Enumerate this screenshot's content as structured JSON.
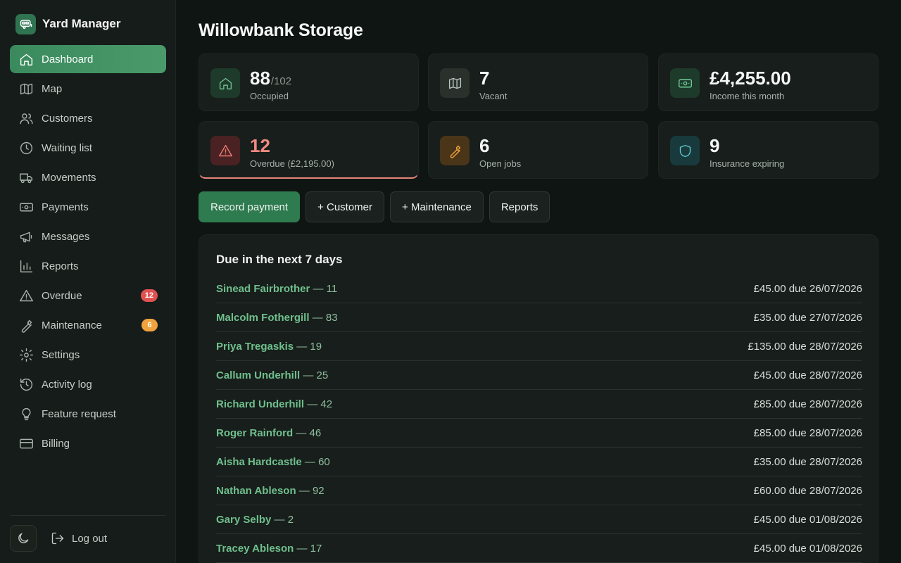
{
  "app": {
    "name": "Yard Manager"
  },
  "sidebar": {
    "items": [
      {
        "label": "Dashboard",
        "icon": "home-icon",
        "active": true
      },
      {
        "label": "Map",
        "icon": "map-icon"
      },
      {
        "label": "Customers",
        "icon": "users-icon"
      },
      {
        "label": "Waiting list",
        "icon": "clock-icon"
      },
      {
        "label": "Movements",
        "icon": "truck-icon"
      },
      {
        "label": "Payments",
        "icon": "banknote-icon"
      },
      {
        "label": "Messages",
        "icon": "megaphone-icon"
      },
      {
        "label": "Reports",
        "icon": "bar-chart-icon"
      },
      {
        "label": "Overdue",
        "icon": "alert-triangle-icon",
        "badge": "12"
      },
      {
        "label": "Maintenance",
        "icon": "wrench-icon",
        "badge": "6"
      },
      {
        "label": "Settings",
        "icon": "gear-icon"
      },
      {
        "label": "Activity log",
        "icon": "history-icon"
      },
      {
        "label": "Feature request",
        "icon": "lightbulb-icon"
      },
      {
        "label": "Billing",
        "icon": "credit-card-icon"
      }
    ],
    "logout_label": "Log out",
    "theme_toggle_icon": "moon-icon"
  },
  "page": {
    "title": "Willowbank Storage"
  },
  "stats": {
    "occupied": {
      "value": "88",
      "total": "/102",
      "label": "Occupied",
      "icon": "home-icon"
    },
    "vacant": {
      "value": "7",
      "label": "Vacant",
      "icon": "map-icon"
    },
    "income": {
      "value": "£4,255.00",
      "label": "Income this month",
      "icon": "banknote-icon"
    },
    "overdue": {
      "value": "12",
      "label": "Overdue (£2,195.00)",
      "icon": "alert-triangle-icon"
    },
    "jobs": {
      "value": "6",
      "label": "Open jobs",
      "icon": "wrench-icon"
    },
    "insurance": {
      "value": "9",
      "label": "Insurance expiring",
      "icon": "shield-icon"
    }
  },
  "actions": {
    "record_payment": "Record payment",
    "add_customer": "+ Customer",
    "add_maintenance": "+ Maintenance",
    "reports": "Reports"
  },
  "due": {
    "title": "Due in the next 7 days",
    "rows": [
      {
        "name": "Sinead Fairbrother",
        "bay": " — 11",
        "amount": "£45.00 due 26/07/2026"
      },
      {
        "name": "Malcolm Fothergill",
        "bay": " — 83",
        "amount": "£35.00 due 27/07/2026"
      },
      {
        "name": "Priya Tregaskis",
        "bay": " — 19",
        "amount": "£135.00 due 28/07/2026"
      },
      {
        "name": "Callum Underhill",
        "bay": " — 25",
        "amount": "£45.00 due 28/07/2026"
      },
      {
        "name": "Richard Underhill",
        "bay": " — 42",
        "amount": "£85.00 due 28/07/2026"
      },
      {
        "name": "Roger Rainford",
        "bay": " — 46",
        "amount": "£85.00 due 28/07/2026"
      },
      {
        "name": "Aisha Hardcastle",
        "bay": " — 60",
        "amount": "£35.00 due 28/07/2026"
      },
      {
        "name": "Nathan Ableson",
        "bay": " — 92",
        "amount": "£60.00 due 28/07/2026"
      },
      {
        "name": "Gary Selby",
        "bay": " — 2",
        "amount": "£45.00 due 01/08/2026"
      },
      {
        "name": "Tracey Ableson",
        "bay": " — 17",
        "amount": "£45.00 due 01/08/2026"
      }
    ]
  },
  "colors": {
    "accent": "#3a8a5d",
    "danger": "#e05252",
    "warning": "#f0a23e",
    "link": "#6fbf8d"
  }
}
